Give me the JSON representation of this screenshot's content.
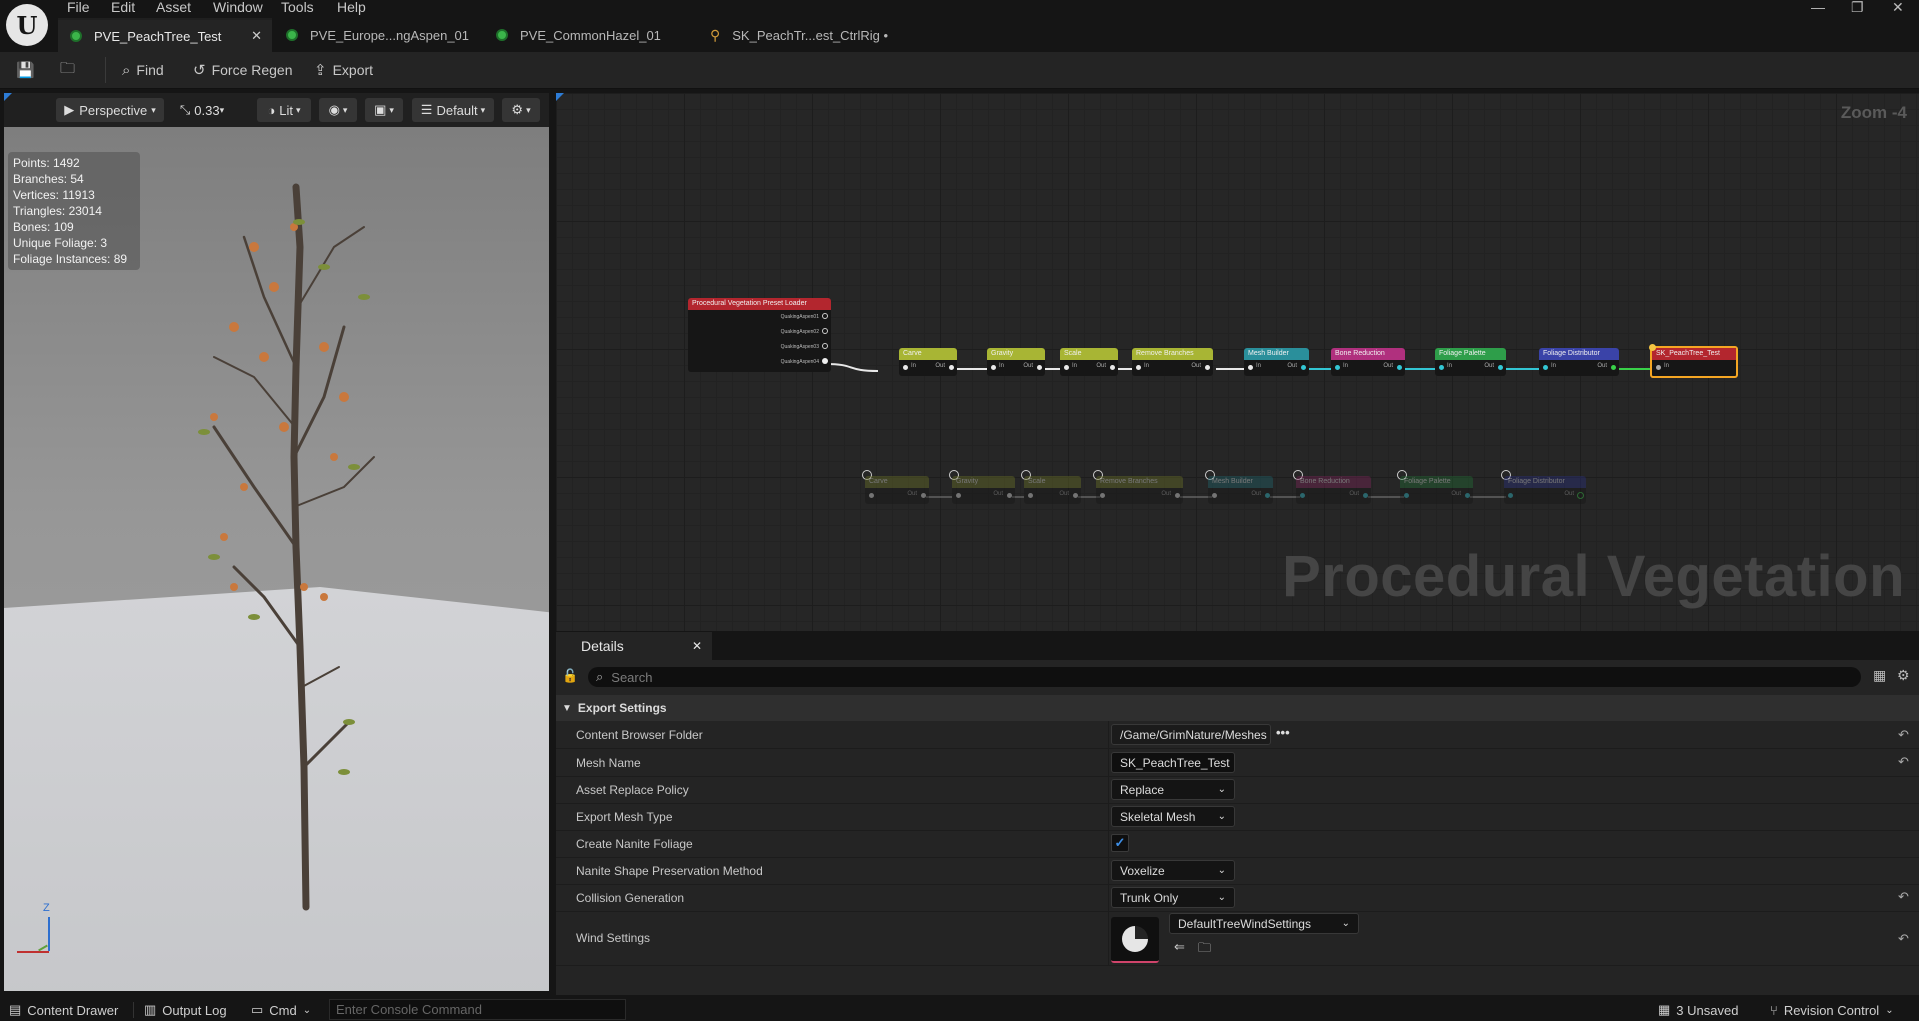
{
  "menu": [
    "File",
    "Edit",
    "Asset",
    "Window",
    "Tools",
    "Help"
  ],
  "tabs": [
    {
      "label": "PVE_PeachTree_Test",
      "active": true
    },
    {
      "label": "PVE_Europe...ngAspen_01",
      "active": false
    },
    {
      "label": "PVE_CommonHazel_01",
      "active": false
    },
    {
      "label": "SK_PeachTr...est_CtrlRig •",
      "active": false
    }
  ],
  "toolbar": {
    "find": "Find",
    "force_regen": "Force Regen",
    "export": "Export"
  },
  "viewport": {
    "perspective": "Perspective",
    "speed": "0.33",
    "lit": "Lit",
    "preset": "Default",
    "stats": [
      "Points: 1492",
      "Branches: 54",
      "Vertices: 11913",
      "Triangles: 23014",
      "Bones: 109",
      "Unique Foliage: 3",
      "Foliage Instances: 89"
    ],
    "axis_z": "Z"
  },
  "graph": {
    "zoom": "Zoom -4",
    "watermark": "Procedural Vegetation",
    "loader": {
      "title": "Procedural Vegetation Preset Loader",
      "outputs": [
        "QuakingAspen01",
        "QuakingAspen02",
        "QuakingAspen03",
        "QuakingAspen04"
      ]
    },
    "main_nodes": [
      "Carve",
      "Gravity",
      "Scale",
      "Remove Branches",
      "Mesh Builder",
      "Bone Reduction",
      "Foliage Palette",
      "Foliage Distributor",
      "SK_PeachTree_Test"
    ],
    "disabled_nodes": [
      "Carve",
      "Gravity",
      "Scale",
      "Remove Branches",
      "Mesh Builder",
      "Bone Reduction",
      "Foliage Palette",
      "Foliage Distributor"
    ],
    "pin_in": "In",
    "pin_out": "Out"
  },
  "details": {
    "tab": "Details",
    "search_placeholder": "Search",
    "section": "Export Settings",
    "content_browser_folder": {
      "label": "Content Browser Folder",
      "value": "/Game/GrimNature/Meshes"
    },
    "mesh_name": {
      "label": "Mesh Name",
      "value": "SK_PeachTree_Test"
    },
    "asset_replace_policy": {
      "label": "Asset Replace Policy",
      "value": "Replace"
    },
    "export_mesh_type": {
      "label": "Export Mesh Type",
      "value": "Skeletal Mesh"
    },
    "create_nanite_foliage": {
      "label": "Create Nanite Foliage",
      "checked": true
    },
    "nanite_shape": {
      "label": "Nanite Shape Preservation Method",
      "value": "Voxelize"
    },
    "collision": {
      "label": "Collision Generation",
      "value": "Trunk Only"
    },
    "wind": {
      "label": "Wind Settings",
      "value": "DefaultTreeWindSettings"
    }
  },
  "statusbar": {
    "content_drawer": "Content Drawer",
    "output_log": "Output Log",
    "cmd": "Cmd",
    "console_placeholder": "Enter Console Command",
    "unsaved": "3 Unsaved",
    "revision_control": "Revision Control"
  },
  "colors": {
    "accent": "#f5a623",
    "node_red": "#b3262e",
    "node_yellow": "#a8b534",
    "node_teal": "#2a8f9b",
    "node_pink": "#b0307e",
    "node_green": "#2e9e4a",
    "node_blue": "#3a43a8"
  }
}
